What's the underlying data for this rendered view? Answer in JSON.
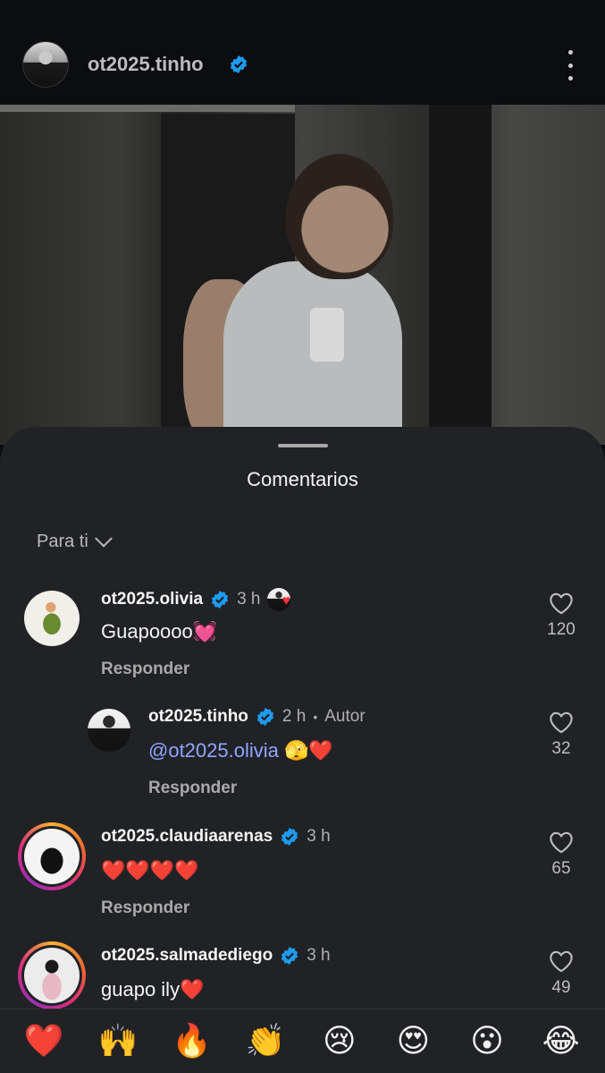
{
  "header": {
    "username": "ot2025.tinho",
    "more_icon": "more-vertical-icon"
  },
  "sheet": {
    "title": "Comentarios",
    "sort_label": "Para ti"
  },
  "comments": [
    {
      "username": "ot2025.olivia",
      "time": "3 h",
      "text": "Guapoooo💓",
      "reply_label": "Responder",
      "likes": "120",
      "liked_by_author": true
    },
    {
      "username": "ot2025.tinho",
      "time": "2 h",
      "separator": "•",
      "badge": "Autor",
      "mention": "@ot2025.olivia",
      "text": " 🫣❤️",
      "reply_label": "Responder",
      "likes": "32"
    },
    {
      "username": "ot2025.claudiaarenas",
      "time": "3 h",
      "text": "❤️❤️❤️❤️",
      "reply_label": "Responder",
      "likes": "65"
    },
    {
      "username": "ot2025.salmadediego",
      "time": "3 h",
      "text": "guapo ily❤️",
      "likes": "49"
    }
  ],
  "reactions": [
    "❤️",
    "🙌",
    "🔥",
    "👏",
    "😢",
    "😍",
    "😮",
    "😂"
  ],
  "colors": {
    "background": "#0c0d10",
    "sheet": "#212226",
    "verified": "#1d9bf0",
    "mention": "#8fa6ff",
    "like_heart": "#ff3040"
  }
}
